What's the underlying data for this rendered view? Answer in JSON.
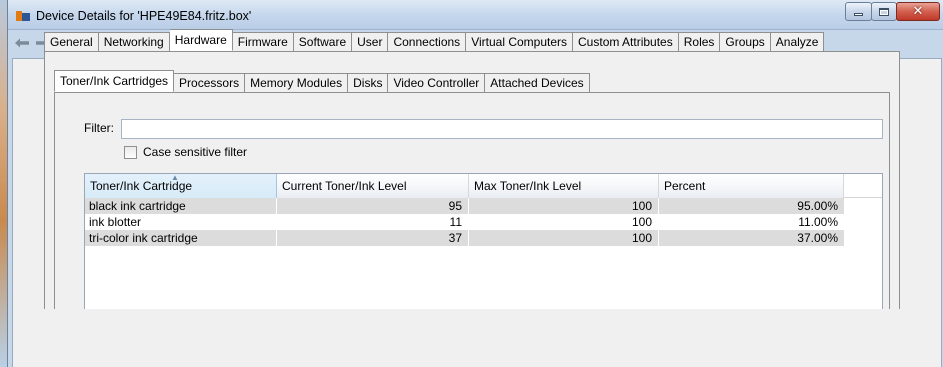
{
  "window": {
    "title": "Device Details for 'HPE49E84.fritz.box'"
  },
  "toolbar": {
    "icons": [
      "back-arrow-icon",
      "forward-arrow-icon",
      "refresh-icon",
      "print-icon",
      "copy-icon",
      "export-excel-icon",
      "document-icon",
      "database-icon",
      "network-topology-icon",
      "clone-icon"
    ]
  },
  "tabs": {
    "outer": [
      "General",
      "Networking",
      "Hardware",
      "Firmware",
      "Software",
      "User",
      "Connections",
      "Virtual Computers",
      "Custom Attributes",
      "Roles",
      "Groups",
      "Analyze"
    ],
    "outer_active": "Hardware",
    "inner": [
      "Toner/Ink Cartridges",
      "Processors",
      "Memory Modules",
      "Disks",
      "Video Controller",
      "Attached Devices"
    ],
    "inner_active": "Toner/Ink Cartridges"
  },
  "filter": {
    "label": "Filter:",
    "value": "",
    "case_label": "Case sensitive filter",
    "case_checked": false
  },
  "grid": {
    "columns": [
      "Toner/Ink Cartridge",
      "Current Toner/Ink Level",
      "Max Toner/Ink Level",
      "Percent"
    ],
    "sorted_column": "Toner/Ink Cartridge",
    "rows": [
      [
        "black ink cartridge",
        "95",
        "100",
        "95.00%"
      ],
      [
        "ink blotter",
        "11",
        "100",
        "11.00%"
      ],
      [
        "tri-color ink cartridge",
        "37",
        "100",
        "37.00%"
      ]
    ]
  },
  "colors": {
    "titlebar": "#c4d6ec",
    "close_button": "#c0392b",
    "row_stripe": "#dcdcdc",
    "sorted_header": "#d7ebf8"
  }
}
